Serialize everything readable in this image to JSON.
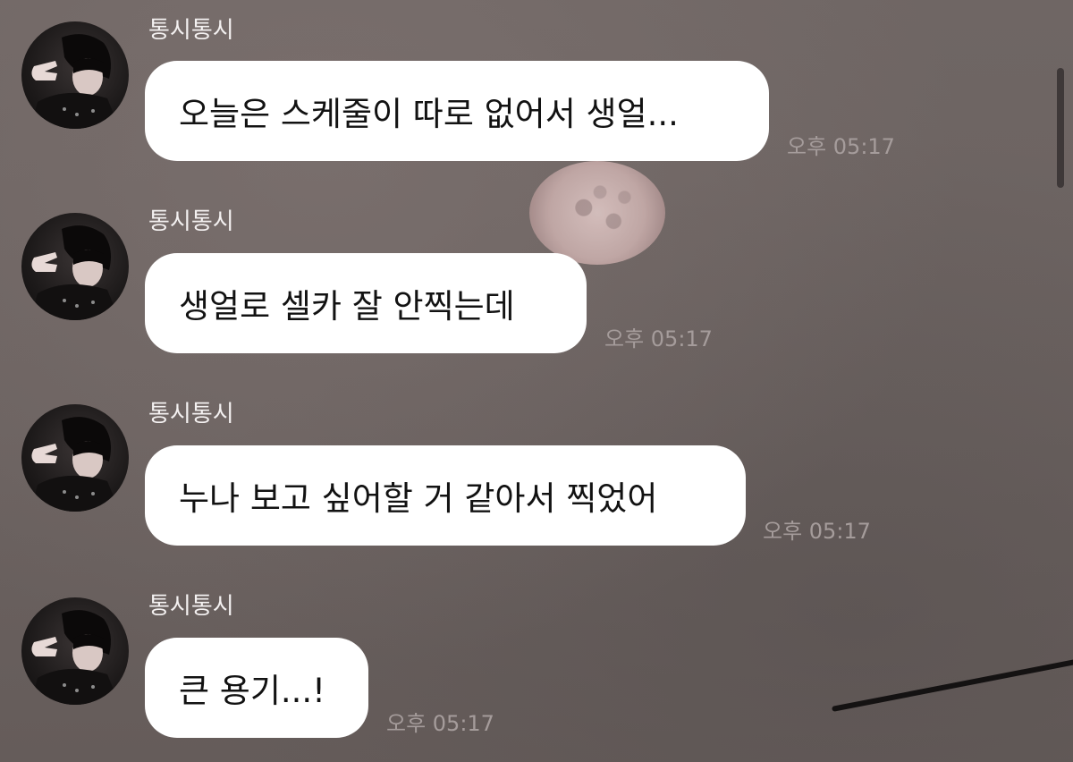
{
  "chat": {
    "messages": [
      {
        "sender": "통시통시",
        "text": "오늘은 스케줄이 따로 없어서 생얼...",
        "time": "오후 05:17"
      },
      {
        "sender": "통시통시",
        "text": "생얼로 셀카 잘 안찍는데",
        "time": "오후 05:17"
      },
      {
        "sender": "통시통시",
        "text": "누나 보고 싶어할 거 같아서 찍었어",
        "time": "오후 05:17"
      },
      {
        "sender": "통시통시",
        "text": "큰 용기...!",
        "time": "오후 05:17"
      }
    ]
  },
  "colors": {
    "background": "#6e6563",
    "bubble": "#ffffff",
    "sender_text": "#f4f1f1",
    "time_text": "#a59c9b"
  },
  "icons": {
    "avatar": "profile-photo"
  }
}
